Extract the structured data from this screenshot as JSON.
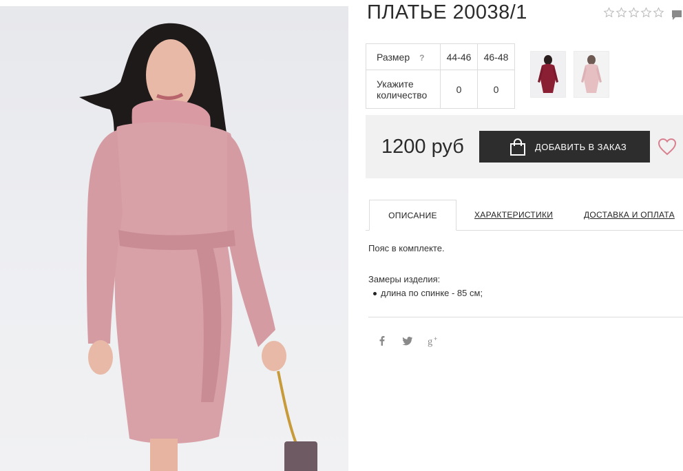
{
  "product": {
    "title": "ПЛАТЬЕ 20038/1",
    "rating_stars": 0,
    "rating_max": 5
  },
  "sizes": {
    "size_label": "Размер",
    "help_mark": "?",
    "size_values": [
      "44-46",
      "46-48"
    ],
    "qty_label_line1": "Укажите",
    "qty_label_line2": "количество",
    "qty_values": [
      "0",
      "0"
    ]
  },
  "thumbnails": [
    {
      "icon": "burgundy-dress-thumbnail",
      "color": "#8a1f33"
    },
    {
      "icon": "pink-dress-thumbnail",
      "color": "#e5bfc2"
    }
  ],
  "purchase": {
    "price": "1200 руб",
    "add_button": "ДОБАВИТЬ В ЗАКАЗ",
    "button_color": "#2d2d2d",
    "favorite_color": "#d9808f"
  },
  "tabs": [
    {
      "label": "ОПИСАНИЕ",
      "active": true
    },
    {
      "label": "ХАРАКТЕРИСТИКИ",
      "active": false
    },
    {
      "label": "ДОСТАВКА И ОПЛАТА",
      "active": false
    }
  ],
  "description": {
    "line1": "Пояс в комплекте.",
    "measure_title": "Замеры изделия:",
    "items": [
      "длина по спинке - 85 см;"
    ]
  },
  "social": {
    "facebook": "f",
    "twitter": "twitter-bird-icon",
    "googleplus": "g+"
  }
}
